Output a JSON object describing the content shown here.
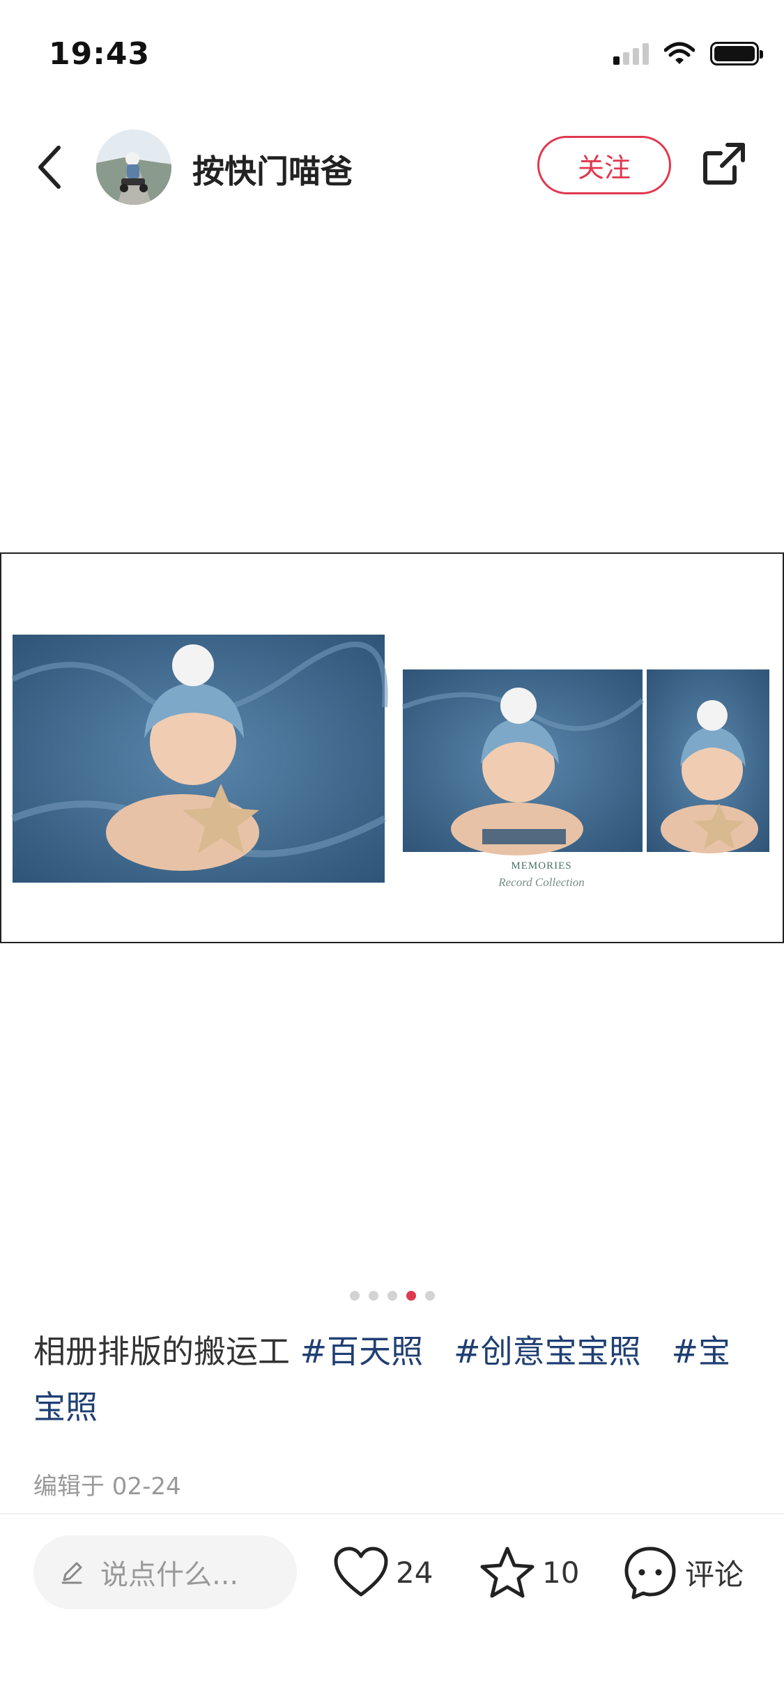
{
  "status_bar": {
    "time": "19:43"
  },
  "header": {
    "author_name": "按快门喵爸",
    "follow_label": "关注"
  },
  "photo": {
    "memories_title": "MEMORIES",
    "memories_subtitle": "Record Collection"
  },
  "carousel": {
    "page_count": 5,
    "active_index": 3
  },
  "post": {
    "caption_text": "相册排版的搬运工 ",
    "tags": [
      "#百天照",
      "#创意宝宝照",
      "#宝宝照"
    ],
    "edit_time": "编辑于 02-24"
  },
  "bottom_bar": {
    "comment_placeholder": "说点什么...",
    "like_count": "24",
    "collect_count": "10",
    "comment_label": "评论"
  },
  "colors": {
    "accent": "#e0384e",
    "tag": "#1f3f73",
    "photo_bg": "#3f6a90"
  }
}
